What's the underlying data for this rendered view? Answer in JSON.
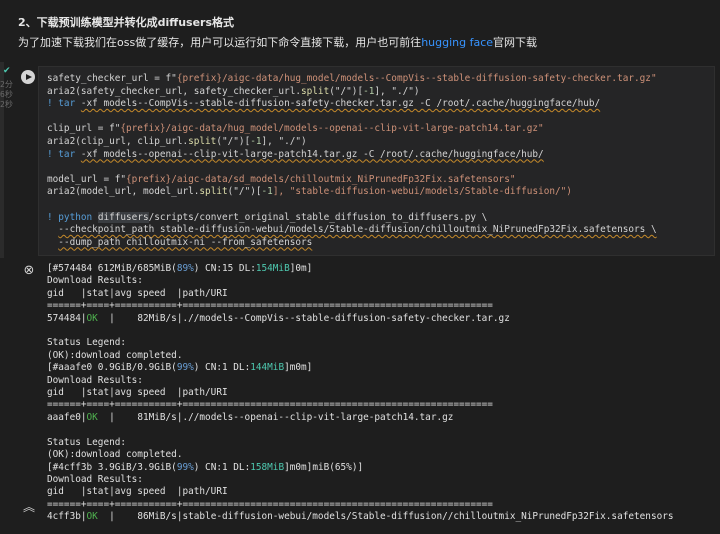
{
  "markdown": {
    "heading": "2、下载预训练模型并转化成diffusers格式",
    "desc_before": "为了加速下载我们在oss做了缓存，用户可以运行如下命令直接下载，用户也可前往",
    "desc_link": "hugging face",
    "desc_after": "官网下载"
  },
  "gutter": {
    "status_icon": "check-circle-icon",
    "exec_labels": [
      "2分",
      "6秒",
      "2秒"
    ]
  },
  "code": {
    "l1_a": "safety_checker_url = f\"",
    "l1_b": "{prefix}",
    "l1_c": "/aigc-data/hug_model/models--CompVis--stable-diffusion-safety-checker.tar.gz\"",
    "l2_a": "aria2(safety_checker_url, safety_checker_url.",
    "l2_b": "split",
    "l2_c": "(\"/\")[",
    "l2_d": "-1",
    "l2_e": "], \"./\")",
    "l3_a": "! tar ",
    "l3_b": "-xf models--CompVis--stable-diffusion-safety-checker.tar.gz -C /root/.cache/huggingface/hub/",
    "l4_a": "clip_url = f\"",
    "l4_b": "{prefix}",
    "l4_c": "/aigc-data/hug_model/models--openai--clip-vit-large-patch14.tar.gz\"",
    "l5_a": "aria2(clip_url, clip_url.",
    "l5_b": "split",
    "l5_c": "(\"/\")[",
    "l5_d": "-1",
    "l5_e": "], \"./\")",
    "l6_a": "! tar ",
    "l6_b": "-xf models--openai--clip-vit-large-patch14.tar.gz -C /root/.cache/huggingface/hub/",
    "l7_a": "model_url = f\"",
    "l7_b": "{prefix}",
    "l7_c": "/aigc-data/sd_models/chilloutmix_NiPrunedFp32Fix.safetensors\"",
    "l8_a": "aria2(model_url, model_url.",
    "l8_b": "split",
    "l8_c": "(\"/\")[",
    "l8_d": "-1",
    "l8_e": "], \"stable-diffusion-webui/models/Stable-diffusion/\")",
    "l9_a": "! python ",
    "l9_b": "diffusers",
    "l9_c": "/scripts/convert_original_stable_diffusion_to_diffusers.py \\",
    "l10": "--checkpoint_path stable-diffusion-webui/models/Stable-diffusion/chilloutmix_NiPrunedFp32Fix.safetensors \\",
    "l11": "--dump_path chilloutmix-ni --from_safetensors"
  },
  "output": {
    "clear_icon": "clear-output-icon",
    "collapse_icon": "collapse-output-icon",
    "b1_progress_a": "[#574484 612MiB/685MiB(",
    "b1_progress_pct": "89%",
    "b1_progress_b": ") CN:15 DL:",
    "b1_progress_dl": "154MiB",
    "b1_progress_c": "]0m]",
    "results_label": "Download Results:",
    "table_header": "gid   |stat|avg speed  |path/URI",
    "separator": "======+====+===========+=======================================================",
    "b1_row_gid": "574484|",
    "b1_row_ok": "OK",
    "b1_row_rest": "  |    82MiB/s|.//models--CompVis--stable-diffusion-safety-checker.tar.gz",
    "legend": "Status Legend:",
    "completed": "(OK):download completed.",
    "b2_progress_a": "[#aaafe0 0.9GiB/0.9GiB(",
    "b2_progress_pct": "99%",
    "b2_progress_b": ") CN:1 DL:",
    "b2_progress_dl": "144MiB",
    "b2_progress_c": "]m0m]",
    "b2_row_gid": "aaafe0|",
    "b2_row_ok": "OK",
    "b2_row_rest": "  |    81MiB/s|.//models--openai--clip-vit-large-patch14.tar.gz",
    "b3_progress_a": "[#4cff3b 3.9GiB/3.9GiB(",
    "b3_progress_pct": "99%",
    "b3_progress_b": ") CN:1 DL:",
    "b3_progress_dl": "158MiB",
    "b3_progress_c": "]m0m]miB(65%)]",
    "b3_row_gid": "4cff3b|",
    "b3_row_ok": "OK",
    "b3_row_rest": "  |    86MiB/s|stable-diffusion-webui/models/Stable-diffusion//chilloutmix_NiPrunedFp32Fix.safetensors"
  }
}
